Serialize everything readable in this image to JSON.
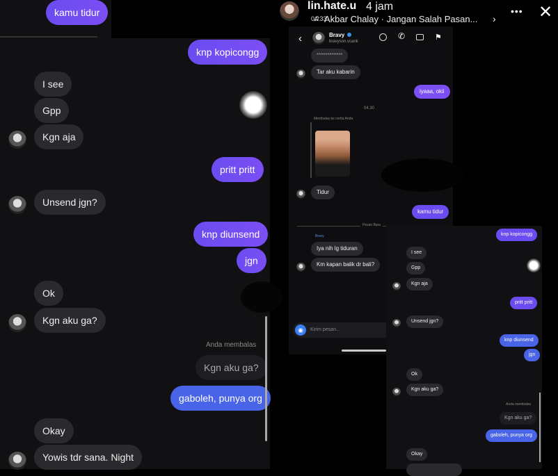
{
  "story": {
    "username": "lin.hate.u",
    "time": "4 jam",
    "music": "Akbar Chalay · Jangan Salah Pasan...",
    "more_label": "•••",
    "close_label": "✕"
  },
  "left": {
    "messages": [
      {
        "text": "kamu tidur"
      },
      {
        "text": "knp kopicongg"
      },
      {
        "text": "I see"
      },
      {
        "text": "Gpp"
      },
      {
        "text": "Kgn aja"
      },
      {
        "text": "pritt pritt"
      },
      {
        "text": "Unsend jgn?"
      },
      {
        "text": "knp diunsend"
      },
      {
        "text": "jgn"
      },
      {
        "text": "Ok"
      },
      {
        "text": "Kgn aku ga?"
      },
      {
        "text": "Anda membalas"
      },
      {
        "text": "Kgn aku ga?"
      },
      {
        "text": "gaboleh, punya org"
      },
      {
        "text": "Okay"
      },
      {
        "text": "Yowis tdr sana. Night"
      }
    ]
  },
  "dm": {
    "status_time": "04:33",
    "contact_name": "Bravy",
    "contact_handle": "bravyson.vcank",
    "masked": "************",
    "messages": [
      {
        "text": "Tar aku kabarin"
      },
      {
        "text": "iyaaa, okii"
      },
      {
        "text": "04.30"
      },
      {
        "text": "Membalas ke cerita Anda"
      },
      {
        "text": "Tidur"
      },
      {
        "text": "kamu tidur"
      },
      {
        "text": "Pesan Baru"
      },
      {
        "text": "Bravy"
      },
      {
        "text": "Iya nih lg tiduran"
      },
      {
        "text": "Km kapan balik dr bali?"
      }
    ],
    "input_placeholder": "Kirim pesan..."
  },
  "thumb": {
    "messages": [
      {
        "text": "knp kopicongg"
      },
      {
        "text": "I see"
      },
      {
        "text": "Gpp"
      },
      {
        "text": "Kgn aja"
      },
      {
        "text": "pritt pritt"
      },
      {
        "text": "Unsend jgn?"
      },
      {
        "text": "knp diunsend"
      },
      {
        "text": "jgn"
      },
      {
        "text": "Ok"
      },
      {
        "text": "Kgn aku ga?"
      },
      {
        "text": "Anda membalas"
      },
      {
        "text": "Kgn aku ga?"
      },
      {
        "text": "gaboleh, punya org"
      },
      {
        "text": "Okay"
      }
    ]
  }
}
